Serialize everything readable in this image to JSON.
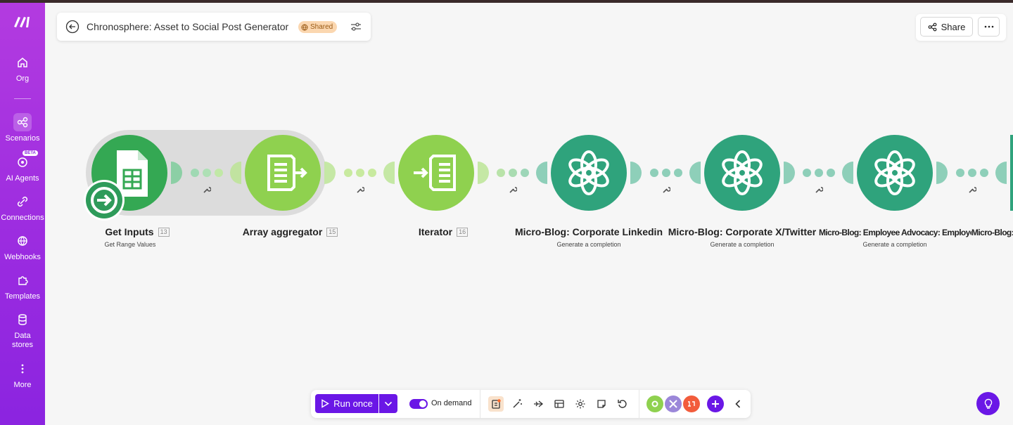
{
  "sidebar": {
    "items": [
      {
        "label": "Org",
        "icon": "home-icon"
      },
      {
        "label": "Scenarios",
        "icon": "scenarios-icon",
        "active": true
      },
      {
        "label": "AI Agents",
        "icon": "ai-agents-icon",
        "badge": "BETA"
      },
      {
        "label": "Connections",
        "icon": "link-icon"
      },
      {
        "label": "Webhooks",
        "icon": "globe-icon"
      },
      {
        "label": "Templates",
        "icon": "puzzle-icon"
      },
      {
        "label": "Data stores",
        "icon": "database-icon"
      },
      {
        "label": "More",
        "icon": "more-vertical-icon"
      }
    ]
  },
  "header": {
    "title": "Chronosphere: Asset to Social Post Generator",
    "shared_label": "Shared",
    "share_label": "Share"
  },
  "modules": [
    {
      "name": "Get Inputs",
      "number": "13",
      "subtitle": "Get Range Values",
      "app": "google-sheets",
      "color": "#34a853"
    },
    {
      "name": "Array aggregator",
      "number": "15",
      "subtitle": "",
      "app": "flow-control",
      "color": "#8fd14f"
    },
    {
      "name": "Iterator",
      "number": "16",
      "subtitle": "",
      "app": "flow-control",
      "color": "#8fd14f"
    },
    {
      "name": "Micro-Blog: Corporate Linkedin",
      "number": "",
      "subtitle": "Generate a completion",
      "app": "openai",
      "color": "#2fa37c"
    },
    {
      "name": "Micro-Blog: Corporate X/Twitter",
      "number": "",
      "subtitle": "Generate a completion",
      "app": "openai",
      "color": "#2fa37c"
    },
    {
      "name": "Micro-Blog: Employee Advocacy: Employee Voice",
      "number": "",
      "subtitle": "Generate a completion",
      "app": "openai",
      "color": "#2fa37c"
    },
    {
      "name": "Micro-Blog: En",
      "number": "",
      "subtitle": "",
      "app": "openai",
      "color": "#2fa37c"
    }
  ],
  "toolbar": {
    "run_label": "Run once",
    "schedule_label": "On demand",
    "accent": "#6a17e6"
  }
}
